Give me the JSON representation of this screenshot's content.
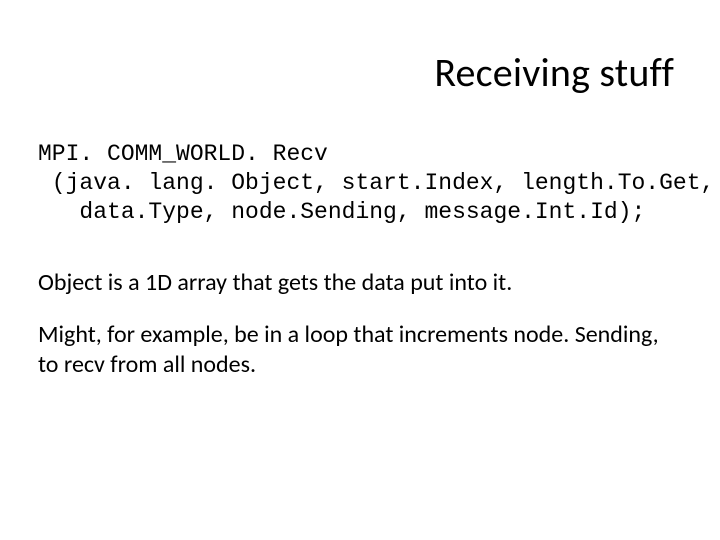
{
  "title": "Receiving stuff",
  "code": {
    "line1": "MPI. COMM_WORLD. Recv",
    "line2": " (java. lang. Object, start.Index, length.To.Get,",
    "line3": "   data.Type, node.Sending, message.Int.Id);"
  },
  "body": {
    "p1": "Object is a 1D array that gets the data put into it.",
    "p2": "Might, for example, be in a loop that increments node. Sending, to recv from all nodes."
  }
}
